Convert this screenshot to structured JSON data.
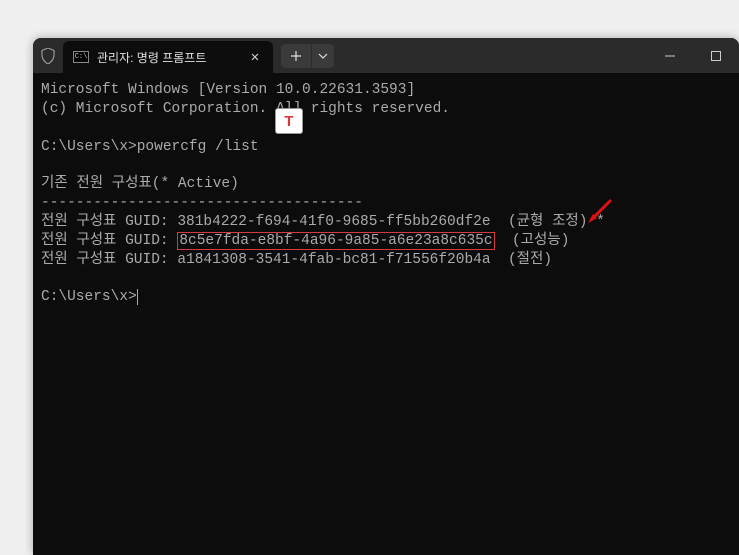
{
  "window": {
    "tab_title": "관리자: 명령 프롬프트"
  },
  "terminal": {
    "line1": "Microsoft Windows [Version 10.0.22631.3593]",
    "line2": "(c) Microsoft Corporation. All rights reserved.",
    "prompt1_path": "C:\\Users\\x>",
    "command1": "powercfg /list",
    "header": "기존 전원 구성표(* Active)",
    "separator": "-------------------------------------",
    "scheme1_label": "전원 구성표 GUID: ",
    "scheme1_guid": "381b4222-f694-41f0-9685-ff5bb260df2e",
    "scheme1_name": "  (균형 조정) *",
    "scheme2_label": "전원 구성표 GUID: ",
    "scheme2_guid": "8c5e7fda-e8bf-4a96-9a85-a6e23a8c635c",
    "scheme2_name": "  (고성능)",
    "scheme3_label": "전원 구성표 GUID: ",
    "scheme3_guid": "a1841308-3541-4fab-bc81-f71556f20b4a",
    "scheme3_name": "  (절전)",
    "prompt2_path": "C:\\Users\\x>"
  },
  "annotation": {
    "letter": "T"
  }
}
